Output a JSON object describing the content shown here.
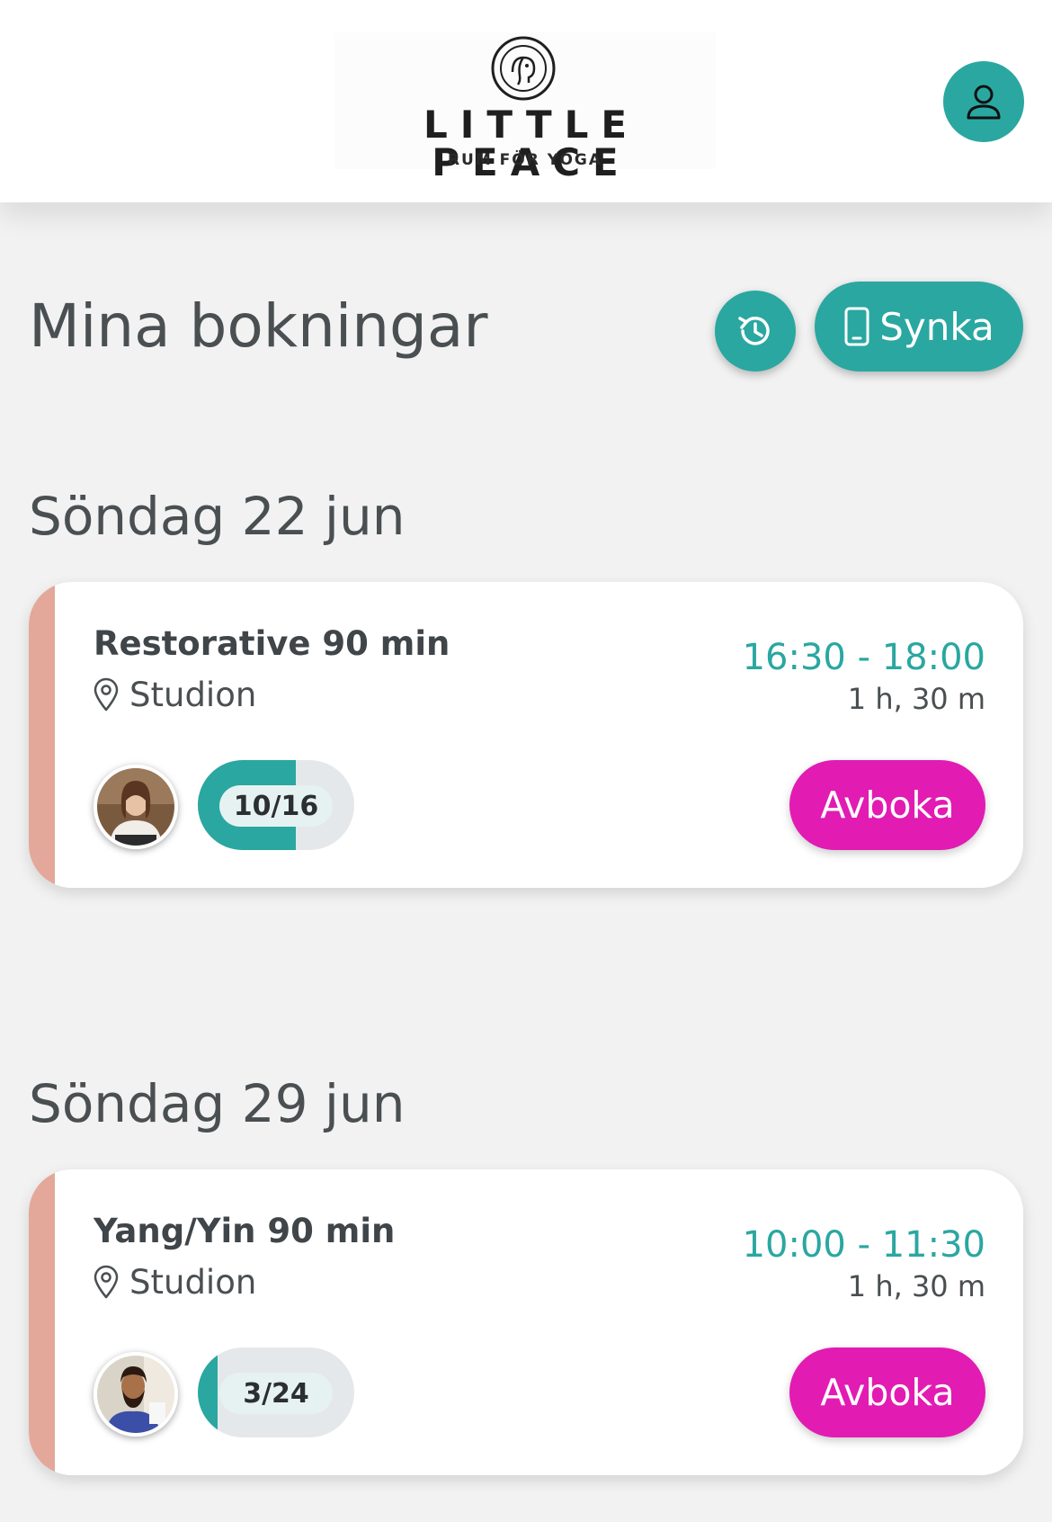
{
  "header": {
    "logo_name": "LITTLE PEACE",
    "logo_tagline": "RUM FÖR YOGA",
    "profile_icon": "user-icon"
  },
  "colors": {
    "accent": "#2aa7a1",
    "cancel": "#e21bb3",
    "card_stripe": "#e3a89a",
    "background": "#f2f2f2"
  },
  "page": {
    "title": "Mina bokningar",
    "history_icon": "history-icon",
    "sync_label": "Synka",
    "sync_icon": "phone-icon"
  },
  "bookings": [
    {
      "date": "Söndag 22 jun",
      "class_name": "Restorative 90 min",
      "location": "Studion",
      "time_range": "16:30 - 18:00",
      "duration": "1 h, 30 m",
      "capacity_label": "10/16",
      "capacity_fraction": 0.625,
      "cancel_label": "Avboka"
    },
    {
      "date": "Söndag 29 jun",
      "class_name": "Yang/Yin 90 min",
      "location": "Studion",
      "time_range": "10:00 - 11:30",
      "duration": "1 h, 30 m",
      "capacity_label": "3/24",
      "capacity_fraction": 0.125,
      "cancel_label": "Avboka"
    }
  ]
}
